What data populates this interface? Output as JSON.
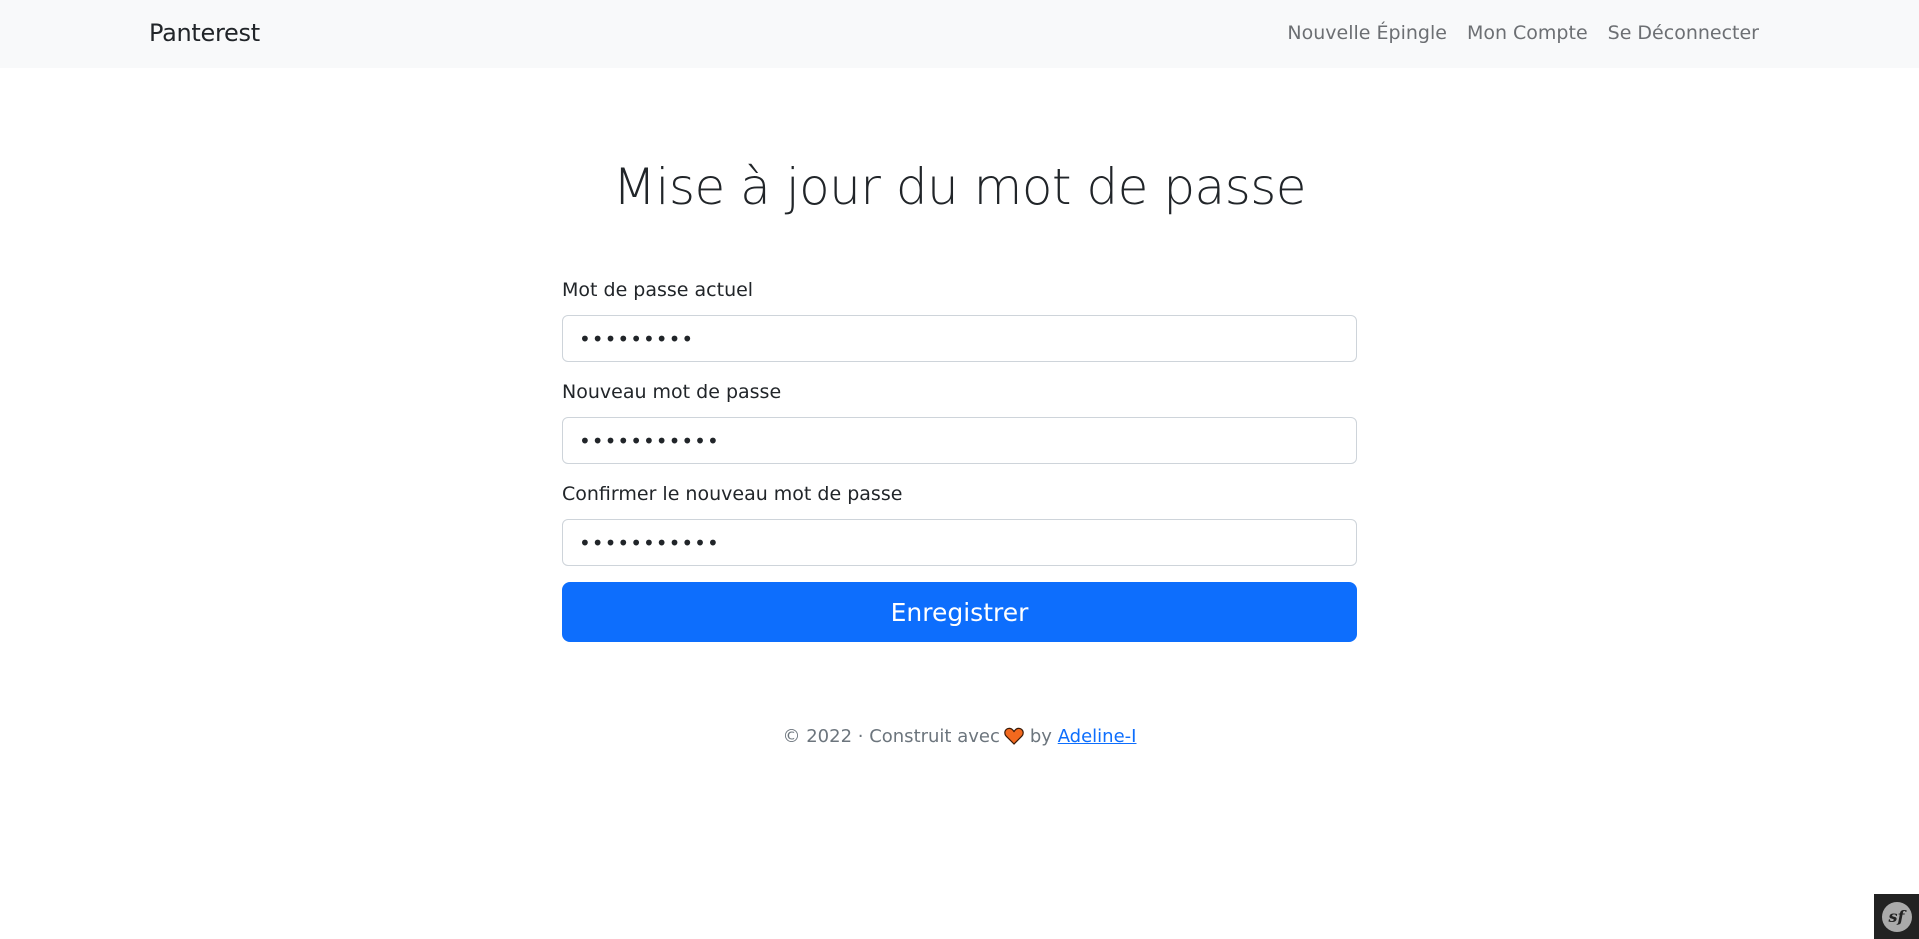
{
  "navbar": {
    "brand": "Panterest",
    "links": [
      {
        "label": "Nouvelle Épingle"
      },
      {
        "label": "Mon Compte"
      },
      {
        "label": "Se Déconnecter"
      }
    ]
  },
  "page": {
    "title": "Mise à jour du mot de passe"
  },
  "form": {
    "current_password": {
      "label": "Mot de passe actuel",
      "value": "•••••••••"
    },
    "new_password": {
      "label": "Nouveau mot de passe",
      "value": "•••••••••••"
    },
    "confirm_password": {
      "label": "Confirmer le nouveau mot de passe",
      "value": "•••••••••••"
    },
    "submit_label": "Enregistrer"
  },
  "footer": {
    "prefix": "© 2022 · Construit avec",
    "by": "by",
    "author": "Adeline-I",
    "heart_icon": "heart-icon"
  },
  "debug_toolbar": {
    "logo_text": "sf",
    "icon": "symfony-icon"
  },
  "colors": {
    "primary": "#0d6efd",
    "navbar_bg": "#f8f9fa",
    "heart": "#f2691e"
  }
}
